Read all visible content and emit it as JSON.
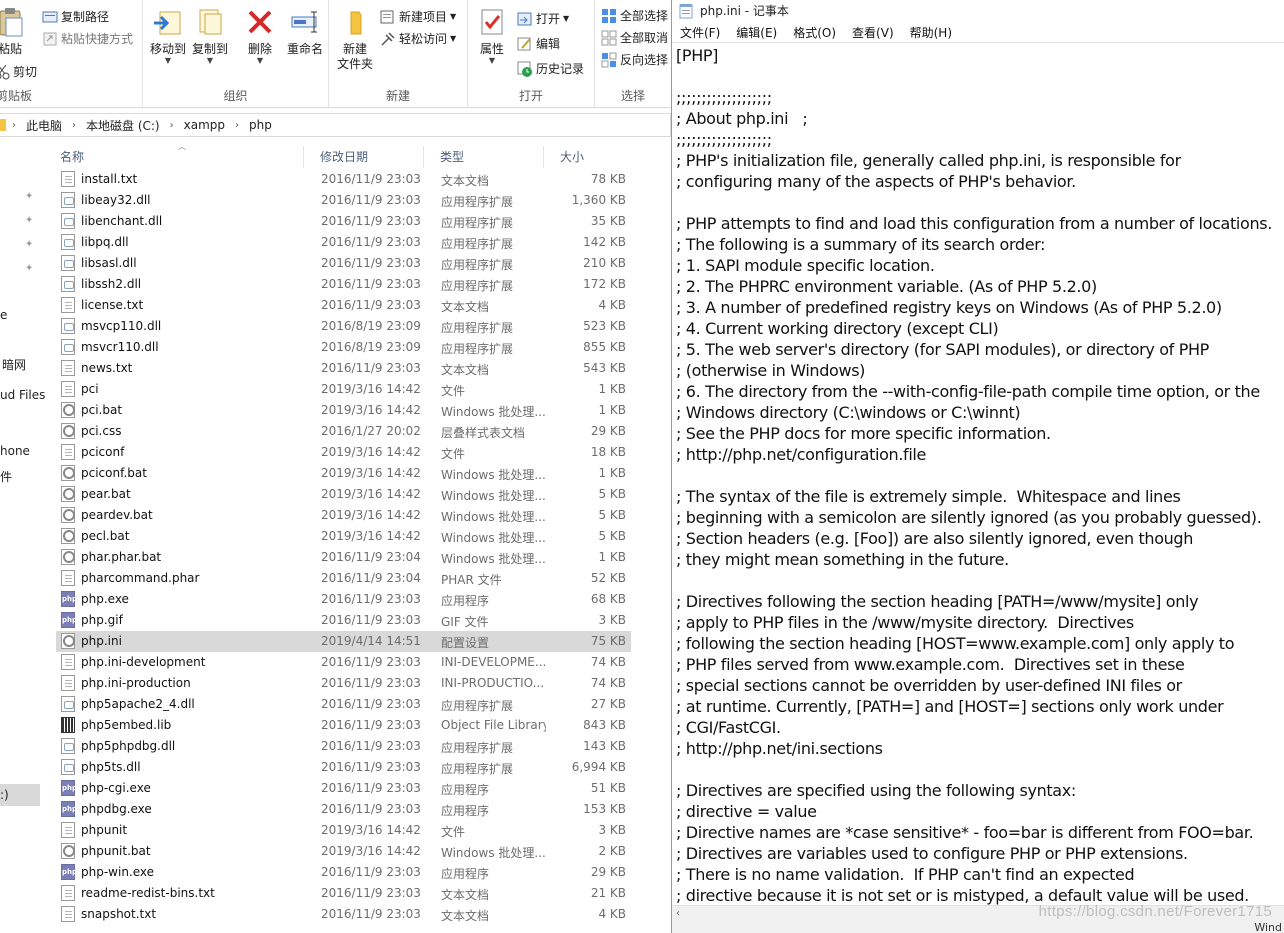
{
  "ribbon": {
    "clipboard": {
      "label": "剪贴板",
      "copy_path": "复制路径",
      "paste_shortcut": "粘贴快捷方式",
      "paste": "粘贴",
      "cut": "剪切"
    },
    "organize": {
      "label": "组织",
      "move_to": "移动到",
      "copy_to": "复制到",
      "delete": "删除",
      "rename": "重命名"
    },
    "new": {
      "label": "新建",
      "new_item": "新建项目",
      "easy_access": "轻松访问",
      "new_folder_line1": "新建",
      "new_folder_line2": "文件夹"
    },
    "open": {
      "label": "打开",
      "properties": "属性",
      "open": "打开",
      "edit": "编辑",
      "history": "历史记录"
    },
    "select": {
      "label": "选择",
      "select_all": "全部选择",
      "select_none": "全部取消",
      "invert": "反向选择"
    }
  },
  "address": {
    "crumbs": [
      "此电脑",
      "本地磁盘 (C:)",
      "xampp",
      "php"
    ]
  },
  "nav": {
    "items": [
      "e",
      "暗网",
      "ud Files",
      "hone",
      "件",
      ":)"
    ]
  },
  "columns": {
    "name": "名称",
    "date": "修改日期",
    "type": "类型",
    "size": "大小"
  },
  "files": [
    {
      "name": "install.txt",
      "date": "2016/11/9 23:03",
      "type": "文本文档",
      "size": "78 KB",
      "icon": "doc"
    },
    {
      "name": "libeay32.dll",
      "date": "2016/11/9 23:03",
      "type": "应用程序扩展",
      "size": "1,360 KB",
      "icon": "dll"
    },
    {
      "name": "libenchant.dll",
      "date": "2016/11/9 23:03",
      "type": "应用程序扩展",
      "size": "35 KB",
      "icon": "dll"
    },
    {
      "name": "libpq.dll",
      "date": "2016/11/9 23:03",
      "type": "应用程序扩展",
      "size": "142 KB",
      "icon": "dll"
    },
    {
      "name": "libsasl.dll",
      "date": "2016/11/9 23:03",
      "type": "应用程序扩展",
      "size": "210 KB",
      "icon": "dll"
    },
    {
      "name": "libssh2.dll",
      "date": "2016/11/9 23:03",
      "type": "应用程序扩展",
      "size": "172 KB",
      "icon": "dll"
    },
    {
      "name": "license.txt",
      "date": "2016/11/9 23:03",
      "type": "文本文档",
      "size": "4 KB",
      "icon": "doc"
    },
    {
      "name": "msvcp110.dll",
      "date": "2016/8/19 23:09",
      "type": "应用程序扩展",
      "size": "523 KB",
      "icon": "dll"
    },
    {
      "name": "msvcr110.dll",
      "date": "2016/8/19 23:09",
      "type": "应用程序扩展",
      "size": "855 KB",
      "icon": "dll"
    },
    {
      "name": "news.txt",
      "date": "2016/11/9 23:03",
      "type": "文本文档",
      "size": "543 KB",
      "icon": "doc"
    },
    {
      "name": "pci",
      "date": "2019/3/16 14:42",
      "type": "文件",
      "size": "1 KB",
      "icon": "blank"
    },
    {
      "name": "pci.bat",
      "date": "2019/3/16 14:42",
      "type": "Windows 批处理...",
      "size": "1 KB",
      "icon": "gear"
    },
    {
      "name": "pci.css",
      "date": "2016/1/27 20:02",
      "type": "层叠样式表文档",
      "size": "29 KB",
      "icon": "gear"
    },
    {
      "name": "pciconf",
      "date": "2019/3/16 14:42",
      "type": "文件",
      "size": "18 KB",
      "icon": "blank"
    },
    {
      "name": "pciconf.bat",
      "date": "2019/3/16 14:42",
      "type": "Windows 批处理...",
      "size": "1 KB",
      "icon": "gear"
    },
    {
      "name": "pear.bat",
      "date": "2019/3/16 14:42",
      "type": "Windows 批处理...",
      "size": "5 KB",
      "icon": "gear"
    },
    {
      "name": "peardev.bat",
      "date": "2019/3/16 14:42",
      "type": "Windows 批处理...",
      "size": "5 KB",
      "icon": "gear"
    },
    {
      "name": "pecl.bat",
      "date": "2019/3/16 14:42",
      "type": "Windows 批处理...",
      "size": "5 KB",
      "icon": "gear"
    },
    {
      "name": "phar.phar.bat",
      "date": "2016/11/9 23:04",
      "type": "Windows 批处理...",
      "size": "1 KB",
      "icon": "gear"
    },
    {
      "name": "pharcommand.phar",
      "date": "2016/11/9 23:04",
      "type": "PHAR 文件",
      "size": "52 KB",
      "icon": "blank"
    },
    {
      "name": "php.exe",
      "date": "2016/11/9 23:03",
      "type": "应用程序",
      "size": "68 KB",
      "icon": "php"
    },
    {
      "name": "php.gif",
      "date": "2016/11/9 23:03",
      "type": "GIF 文件",
      "size": "3 KB",
      "icon": "php"
    },
    {
      "name": "php.ini",
      "date": "2019/4/14 14:51",
      "type": "配置设置",
      "size": "75 KB",
      "icon": "gear",
      "selected": true
    },
    {
      "name": "php.ini-development",
      "date": "2016/11/9 23:03",
      "type": "INI-DEVELOPME...",
      "size": "74 KB",
      "icon": "blank"
    },
    {
      "name": "php.ini-production",
      "date": "2016/11/9 23:03",
      "type": "INI-PRODUCTIO...",
      "size": "74 KB",
      "icon": "blank"
    },
    {
      "name": "php5apache2_4.dll",
      "date": "2016/11/9 23:03",
      "type": "应用程序扩展",
      "size": "27 KB",
      "icon": "dll"
    },
    {
      "name": "php5embed.lib",
      "date": "2016/11/9 23:03",
      "type": "Object File Library",
      "size": "843 KB",
      "icon": "lib"
    },
    {
      "name": "php5phpdbg.dll",
      "date": "2016/11/9 23:03",
      "type": "应用程序扩展",
      "size": "143 KB",
      "icon": "dll"
    },
    {
      "name": "php5ts.dll",
      "date": "2016/11/9 23:03",
      "type": "应用程序扩展",
      "size": "6,994 KB",
      "icon": "dll"
    },
    {
      "name": "php-cgi.exe",
      "date": "2016/11/9 23:03",
      "type": "应用程序",
      "size": "51 KB",
      "icon": "php"
    },
    {
      "name": "phpdbg.exe",
      "date": "2016/11/9 23:03",
      "type": "应用程序",
      "size": "153 KB",
      "icon": "php"
    },
    {
      "name": "phpunit",
      "date": "2019/3/16 14:42",
      "type": "文件",
      "size": "3 KB",
      "icon": "blank"
    },
    {
      "name": "phpunit.bat",
      "date": "2019/3/16 14:42",
      "type": "Windows 批处理...",
      "size": "2 KB",
      "icon": "gear"
    },
    {
      "name": "php-win.exe",
      "date": "2016/11/9 23:03",
      "type": "应用程序",
      "size": "29 KB",
      "icon": "php"
    },
    {
      "name": "readme-redist-bins.txt",
      "date": "2016/11/9 23:03",
      "type": "文本文档",
      "size": "21 KB",
      "icon": "doc"
    },
    {
      "name": "snapshot.txt",
      "date": "2016/11/9 23:03",
      "type": "文本文档",
      "size": "4 KB",
      "icon": "doc"
    }
  ],
  "notepad": {
    "title": "php.ini - 记事本",
    "menus": [
      "文件(F)",
      "编辑(E)",
      "格式(O)",
      "查看(V)",
      "帮助(H)"
    ],
    "content": "[PHP]\n\n;;;;;;;;;;;;;;;;;;;\n; About php.ini   ;\n;;;;;;;;;;;;;;;;;;;\n; PHP's initialization file, generally called php.ini, is responsible for\n; configuring many of the aspects of PHP's behavior.\n\n; PHP attempts to find and load this configuration from a number of locations.\n; The following is a summary of its search order:\n; 1. SAPI module specific location.\n; 2. The PHPRC environment variable. (As of PHP 5.2.0)\n; 3. A number of predefined registry keys on Windows (As of PHP 5.2.0)\n; 4. Current working directory (except CLI)\n; 5. The web server's directory (for SAPI modules), or directory of PHP\n; (otherwise in Windows)\n; 6. The directory from the --with-config-file-path compile time option, or the\n; Windows directory (C:\\windows or C:\\winnt)\n; See the PHP docs for more specific information.\n; http://php.net/configuration.file\n\n; The syntax of the file is extremely simple.  Whitespace and lines\n; beginning with a semicolon are silently ignored (as you probably guessed).\n; Section headers (e.g. [Foo]) are also silently ignored, even though\n; they might mean something in the future.\n\n; Directives following the section heading [PATH=/www/mysite] only\n; apply to PHP files in the /www/mysite directory.  Directives\n; following the section heading [HOST=www.example.com] only apply to\n; PHP files served from www.example.com.  Directives set in these\n; special sections cannot be overridden by user-defined INI files or\n; at runtime. Currently, [PATH=] and [HOST=] sections only work under\n; CGI/FastCGI.\n; http://php.net/ini.sections\n\n; Directives are specified using the following syntax:\n; directive = value\n; Directive names are *case sensitive* - foo=bar is different from FOO=bar.\n; Directives are variables used to configure PHP or PHP extensions.\n; There is no name validation.  If PHP can't find an expected\n; directive because it is not set or is mistyped, a default value will be used.",
    "status": "Wind",
    "watermark": "https://blog.csdn.net/Forever1715"
  }
}
